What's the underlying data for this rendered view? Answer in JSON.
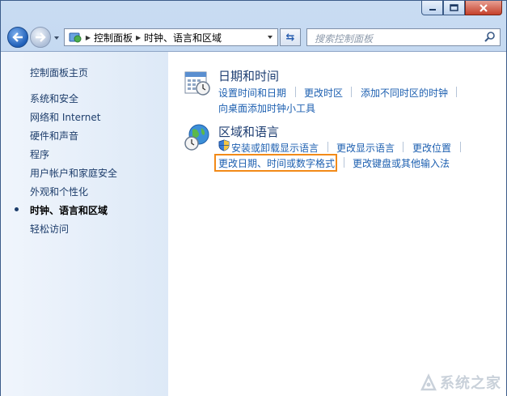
{
  "breadcrumb": {
    "items": [
      "控制面板",
      "时钟、语言和区域"
    ]
  },
  "search": {
    "placeholder": "搜索控制面板"
  },
  "sidebar": {
    "items": [
      {
        "label": "控制面板主页"
      },
      {
        "label": "系统和安全"
      },
      {
        "label": "网络和 Internet"
      },
      {
        "label": "硬件和声音"
      },
      {
        "label": "程序"
      },
      {
        "label": "用户帐户和家庭安全"
      },
      {
        "label": "外观和个性化"
      },
      {
        "label": "时钟、语言和区域",
        "current": true
      },
      {
        "label": "轻松访问"
      }
    ]
  },
  "categories": [
    {
      "title": "日期和时间",
      "icon": "calendar-clock-icon",
      "links": [
        "设置时间和日期",
        "更改时区",
        "添加不同时区的时钟",
        "向桌面添加时钟小工具"
      ]
    },
    {
      "title": "区域和语言",
      "icon": "globe-clock-icon",
      "links": [
        "安装或卸载显示语言",
        "更改显示语言",
        "更改位置",
        "更改日期、时间或数字格式",
        "更改键盘或其他输入法"
      ]
    }
  ],
  "highlighted_link": "更改日期、时间或数字格式",
  "watermark": {
    "text": "系统之家"
  },
  "colors": {
    "link": "#1c5fb0",
    "title": "#1e3e72",
    "highlight": "#f28a18",
    "close_button": "#c5402b"
  }
}
